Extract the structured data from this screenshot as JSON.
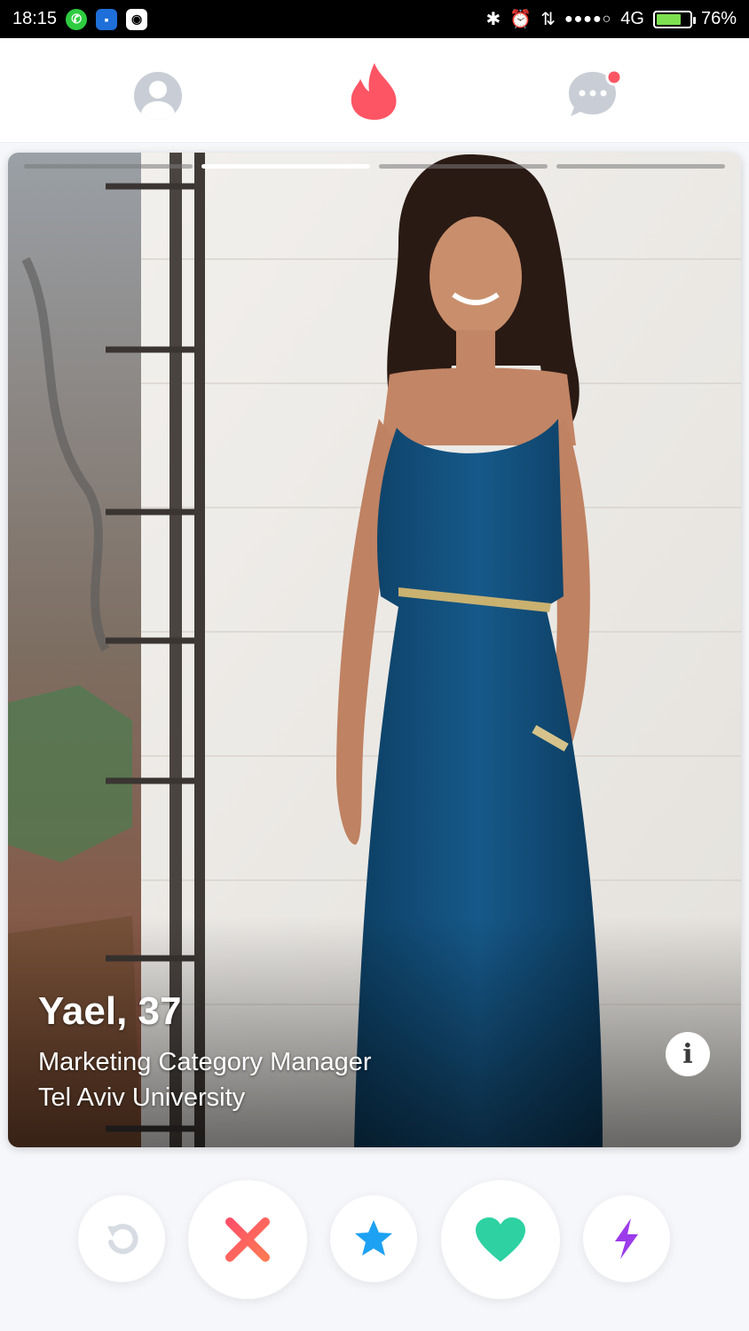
{
  "status_bar": {
    "time": "18:15",
    "network": "4G",
    "battery_percent": "76%",
    "battery_level": 0.76,
    "left_icons": [
      "whatsapp-icon",
      "app-icon",
      "instagram-icon"
    ],
    "right_icons": [
      "bluetooth-icon",
      "alarm-icon",
      "data-arrows-icon",
      "signal-icon",
      "battery-icon"
    ]
  },
  "nav": {
    "tabs": [
      "profile-icon",
      "flame-icon",
      "messages-icon"
    ],
    "active_tab": "flame-icon",
    "messages_has_notification": true,
    "colors": {
      "flame": "#fd5564",
      "inactive": "#c9ced6",
      "notification": "#fd5564"
    }
  },
  "card": {
    "name_age": "Yael, 37",
    "job": "Marketing Category Manager",
    "school": "Tel Aviv University",
    "info_label": "i",
    "photo_count": 4,
    "active_photo_index": 1
  },
  "actions": [
    {
      "name": "rewind-button",
      "icon": "rewind-icon",
      "color": "#d7dce3"
    },
    {
      "name": "nope-button",
      "icon": "x-icon",
      "color": "#fd5068"
    },
    {
      "name": "super-like-button",
      "icon": "star-icon",
      "color": "#1da1f2"
    },
    {
      "name": "like-button",
      "icon": "heart-icon",
      "color": "#2dd1a2"
    },
    {
      "name": "boost-button",
      "icon": "lightning-icon",
      "color": "#9b3bea"
    }
  ]
}
